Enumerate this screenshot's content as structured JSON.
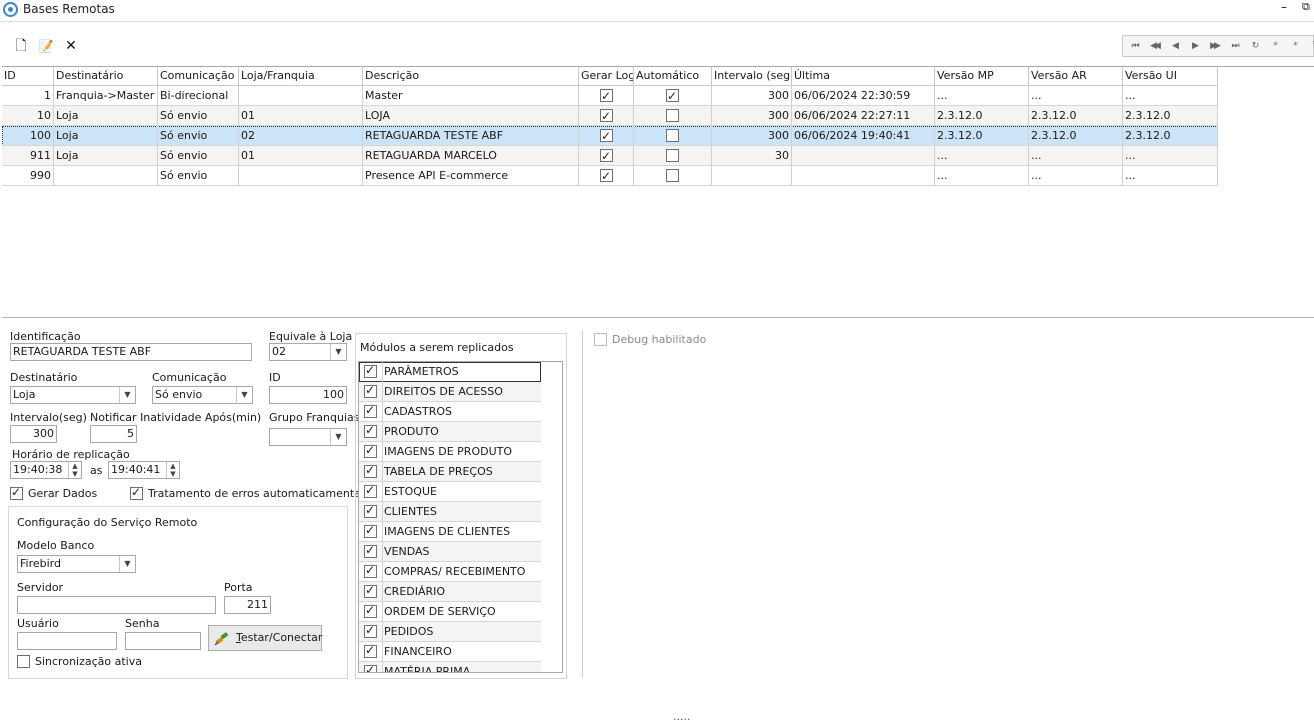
{
  "window": {
    "title": "Bases Remotas",
    "min_glyph": "–",
    "restore_glyph": "⧉"
  },
  "toolbar": {
    "new_icon": "new-document-icon",
    "edit_icon": "edit-document-icon",
    "delete_icon": "delete-x-icon",
    "new_glyph": "🗋",
    "edit_glyph": "📝",
    "delete_glyph": "✕"
  },
  "navigator": {
    "buttons": [
      {
        "name": "first-record-icon",
        "glyph": "⏮"
      },
      {
        "name": "prior-page-icon",
        "glyph": "◀◀"
      },
      {
        "name": "prior-record-icon",
        "glyph": "◀"
      },
      {
        "name": "next-record-icon",
        "glyph": "▶"
      },
      {
        "name": "next-page-icon",
        "glyph": "▶▶"
      },
      {
        "name": "last-record-icon",
        "glyph": "⏭"
      },
      {
        "name": "refresh-icon",
        "glyph": "↻"
      },
      {
        "name": "insert-icon",
        "glyph": "*"
      },
      {
        "name": "cancel-icon",
        "glyph": "*"
      },
      {
        "name": "filter-icon",
        "glyph": "⊽"
      }
    ]
  },
  "grid": {
    "columns": [
      "ID",
      "Destinatário",
      "Comunicação",
      "Loja/Franquia",
      "Descrição",
      "Gerar Log",
      "Automático",
      "Intervalo (seg)",
      "Última",
      "Versão MP",
      "Versão AR",
      "Versão UI"
    ],
    "rows": [
      {
        "id": "1",
        "dest": "Franquia->Master",
        "com": "Bi-direcional",
        "loja": "",
        "desc": "Master",
        "log": true,
        "auto": true,
        "int": "300",
        "ultima": "06/06/2024 22:30:59",
        "mp": "...",
        "ar": "...",
        "ui": "..."
      },
      {
        "id": "10",
        "dest": "Loja",
        "com": "Só envio",
        "loja": "01",
        "desc": "LOJA",
        "log": true,
        "auto": false,
        "int": "300",
        "ultima": "06/06/2024 22:27:11",
        "mp": "2.3.12.0",
        "ar": "2.3.12.0",
        "ui": "2.3.12.0"
      },
      {
        "id": "100",
        "dest": "Loja",
        "com": "Só envio",
        "loja": "02",
        "desc": "RETAGUARDA TESTE ABF",
        "log": true,
        "auto": false,
        "int": "300",
        "ultima": "06/06/2024 19:40:41",
        "mp": "2.3.12.0",
        "ar": "2.3.12.0",
        "ui": "2.3.12.0"
      },
      {
        "id": "911",
        "dest": "Loja",
        "com": "Só envio",
        "loja": "01",
        "desc": "RETAGUARDA MARCELO",
        "log": true,
        "auto": false,
        "int": "30",
        "ultima": "",
        "mp": "...",
        "ar": "...",
        "ui": "..."
      },
      {
        "id": "990",
        "dest": "",
        "com": "Só envio",
        "loja": "",
        "desc": "Presence API E-commerce",
        "log": true,
        "auto": false,
        "int": "",
        "ultima": "",
        "mp": "...",
        "ar": "...",
        "ui": "..."
      }
    ],
    "selected_index": 2
  },
  "form": {
    "identificacao_label": "Identificação",
    "identificacao_value": "RETAGUARDA TESTE ABF",
    "equivale_label": "Equivale à Loja",
    "equivale_value": "02",
    "destinatario_label": "Destinatário",
    "destinatario_value": "Loja",
    "comunicacao_label": "Comunicação",
    "comunicacao_value": "Só envio",
    "id_label": "ID",
    "id_value": "100",
    "intervalo_label": "Intervalo(seg)",
    "intervalo_value": "300",
    "notificar_label": "Notificar Inatividade Após(min)",
    "notificar_value": "5",
    "grupo_label": "Grupo Franquias",
    "grupo_value": "",
    "horario_label": "Horário de replicação",
    "horario_start": "19:40:38",
    "as_label": "as",
    "horario_end": "19:40:41",
    "gerar_dados_label": "Gerar Dados",
    "tratamento_label": "Tratamento de erros automaticamente",
    "debug_label": "Debug habilitado"
  },
  "remote": {
    "title": "Configuração do Serviço Remoto",
    "modelo_label": "Modelo Banco",
    "modelo_value": "Firebird",
    "servidor_label": "Servidor",
    "servidor_value": "",
    "porta_label": "Porta",
    "porta_value": "211",
    "usuario_label": "Usuário",
    "usuario_value": "",
    "senha_label": "Senha",
    "senha_value": "",
    "testar_accel": "T",
    "testar_rest": "estar/Conectar",
    "sincronizacao_label": "Sincronização ativa"
  },
  "modules": {
    "title": "Módulos a serem replicados",
    "items": [
      "PARÂMETROS",
      "DIREITOS DE ACESSO",
      "CADASTROS",
      "PRODUTO",
      "IMAGENS DE PRODUTO",
      "TABELA DE PREÇOS",
      "ESTOQUE",
      "CLIENTES",
      "IMAGENS DE CLIENTES",
      "VENDAS",
      "COMPRAS/ RECEBIMENTO",
      "CREDIÁRIO",
      "ORDEM DE SERVIÇO",
      "PEDIDOS",
      "FINANCEIRO",
      "MATÉRIA PRIMA"
    ]
  },
  "footer": {
    "grip": "....."
  }
}
